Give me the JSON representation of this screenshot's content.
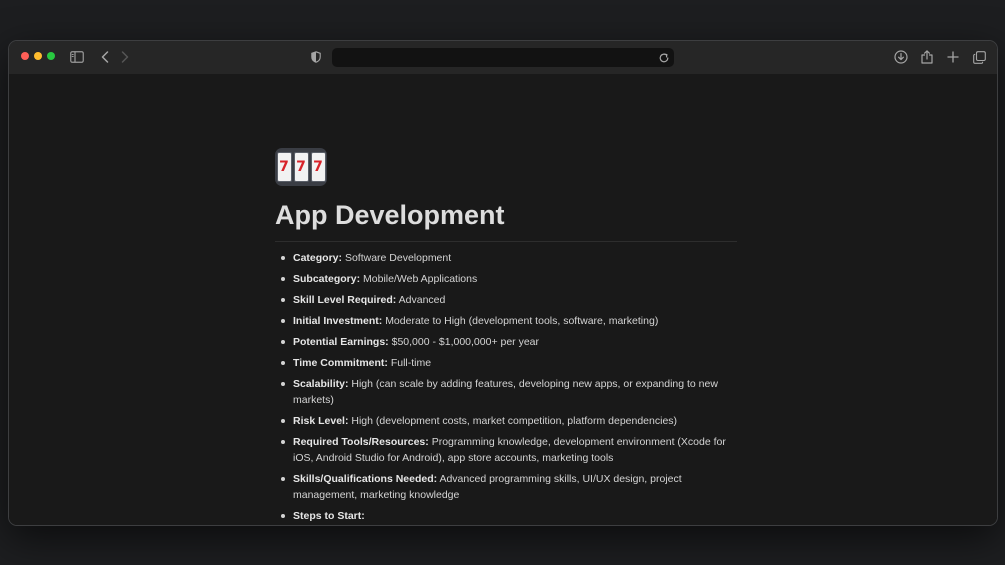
{
  "browser": {
    "toolbar_icons": {
      "sidebar": "sidebar-icon",
      "back": "chevron-left-icon",
      "forward": "chevron-right-icon",
      "privacy": "shield-icon",
      "reload": "reload-icon",
      "downloads": "download-icon",
      "share": "share-icon",
      "new_tab": "plus-icon",
      "tabs": "tab-overview-icon"
    },
    "address": ""
  },
  "page": {
    "icon_glyphs": [
      "7",
      "7",
      "7"
    ],
    "title": "App Development",
    "properties": [
      {
        "label": "Category:",
        "value": "Software Development"
      },
      {
        "label": "Subcategory:",
        "value": "Mobile/Web Applications"
      },
      {
        "label": "Skill Level Required:",
        "value": "Advanced"
      },
      {
        "label": "Initial Investment:",
        "value": "Moderate to High (development tools, software, marketing)"
      },
      {
        "label": "Potential Earnings:",
        "value": "$50,000 - $1,000,000+ per year"
      },
      {
        "label": "Time Commitment:",
        "value": "Full-time"
      },
      {
        "label": "Scalability:",
        "value": "High (can scale by adding features, developing new apps, or expanding to new markets)"
      },
      {
        "label": "Risk Level:",
        "value": "High (development costs, market competition, platform dependencies)"
      },
      {
        "label": "Required Tools/Resources:",
        "value": "Programming knowledge, development environment (Xcode for iOS, Android Studio for Android), app store accounts, marketing tools"
      },
      {
        "label": "Skills/Qualifications Needed:",
        "value": "Advanced programming skills, UI/UX design, project management, marketing knowledge"
      },
      {
        "label": "Steps to Start:",
        "value": ""
      }
    ]
  },
  "colors": {
    "background": "#1d1e20",
    "window": "#191919",
    "toolbar": "#262626",
    "text": "#d4d4d4",
    "title": "#dddddd",
    "close": "#ff5f57",
    "minimize": "#febc2e",
    "maximize": "#28c840"
  }
}
